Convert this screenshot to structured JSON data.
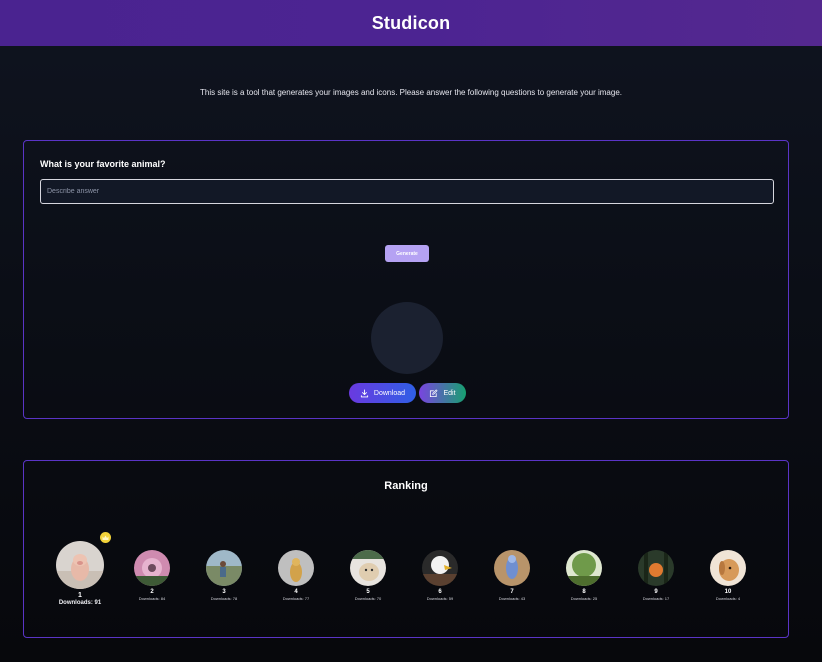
{
  "header": {
    "title": "Studicon"
  },
  "intro": {
    "text": "This site is a tool that generates your images and icons. Please answer the following questions to generate your image."
  },
  "form": {
    "question": "What is your favorite animal?",
    "input_placeholder": "Describe answer",
    "input_value": "",
    "generate_label": "Generate",
    "download_label": "Download",
    "edit_label": "Edit"
  },
  "ranking": {
    "title": "Ranking",
    "items": [
      {
        "rank": "1",
        "downloads": "Downloads: 91",
        "image": "pig-photo"
      },
      {
        "rank": "2",
        "downloads": "Downloads: 84",
        "image": "pink-flower-photo"
      },
      {
        "rank": "3",
        "downloads": "Downloads: 78",
        "image": "person-field-photo"
      },
      {
        "rank": "4",
        "downloads": "Downloads: 77",
        "image": "dog-toy-photo"
      },
      {
        "rank": "5",
        "downloads": "Downloads: 70",
        "image": "cat-photo"
      },
      {
        "rank": "6",
        "downloads": "Downloads: 59",
        "image": "eagle-photo"
      },
      {
        "rank": "7",
        "downloads": "Downloads: 43",
        "image": "bird-photo"
      },
      {
        "rank": "8",
        "downloads": "Downloads: 25",
        "image": "tree-photo"
      },
      {
        "rank": "9",
        "downloads": "Downloads: 17",
        "image": "forest-sunset-photo"
      },
      {
        "rank": "10",
        "downloads": "Downloads: 4",
        "image": "golden-dog-photo"
      }
    ]
  },
  "colors": {
    "header_accent": "#4a2390",
    "panel_border": "#5a34c6",
    "generate_button": "#b5a2f3",
    "crown": "#f2d33a"
  }
}
